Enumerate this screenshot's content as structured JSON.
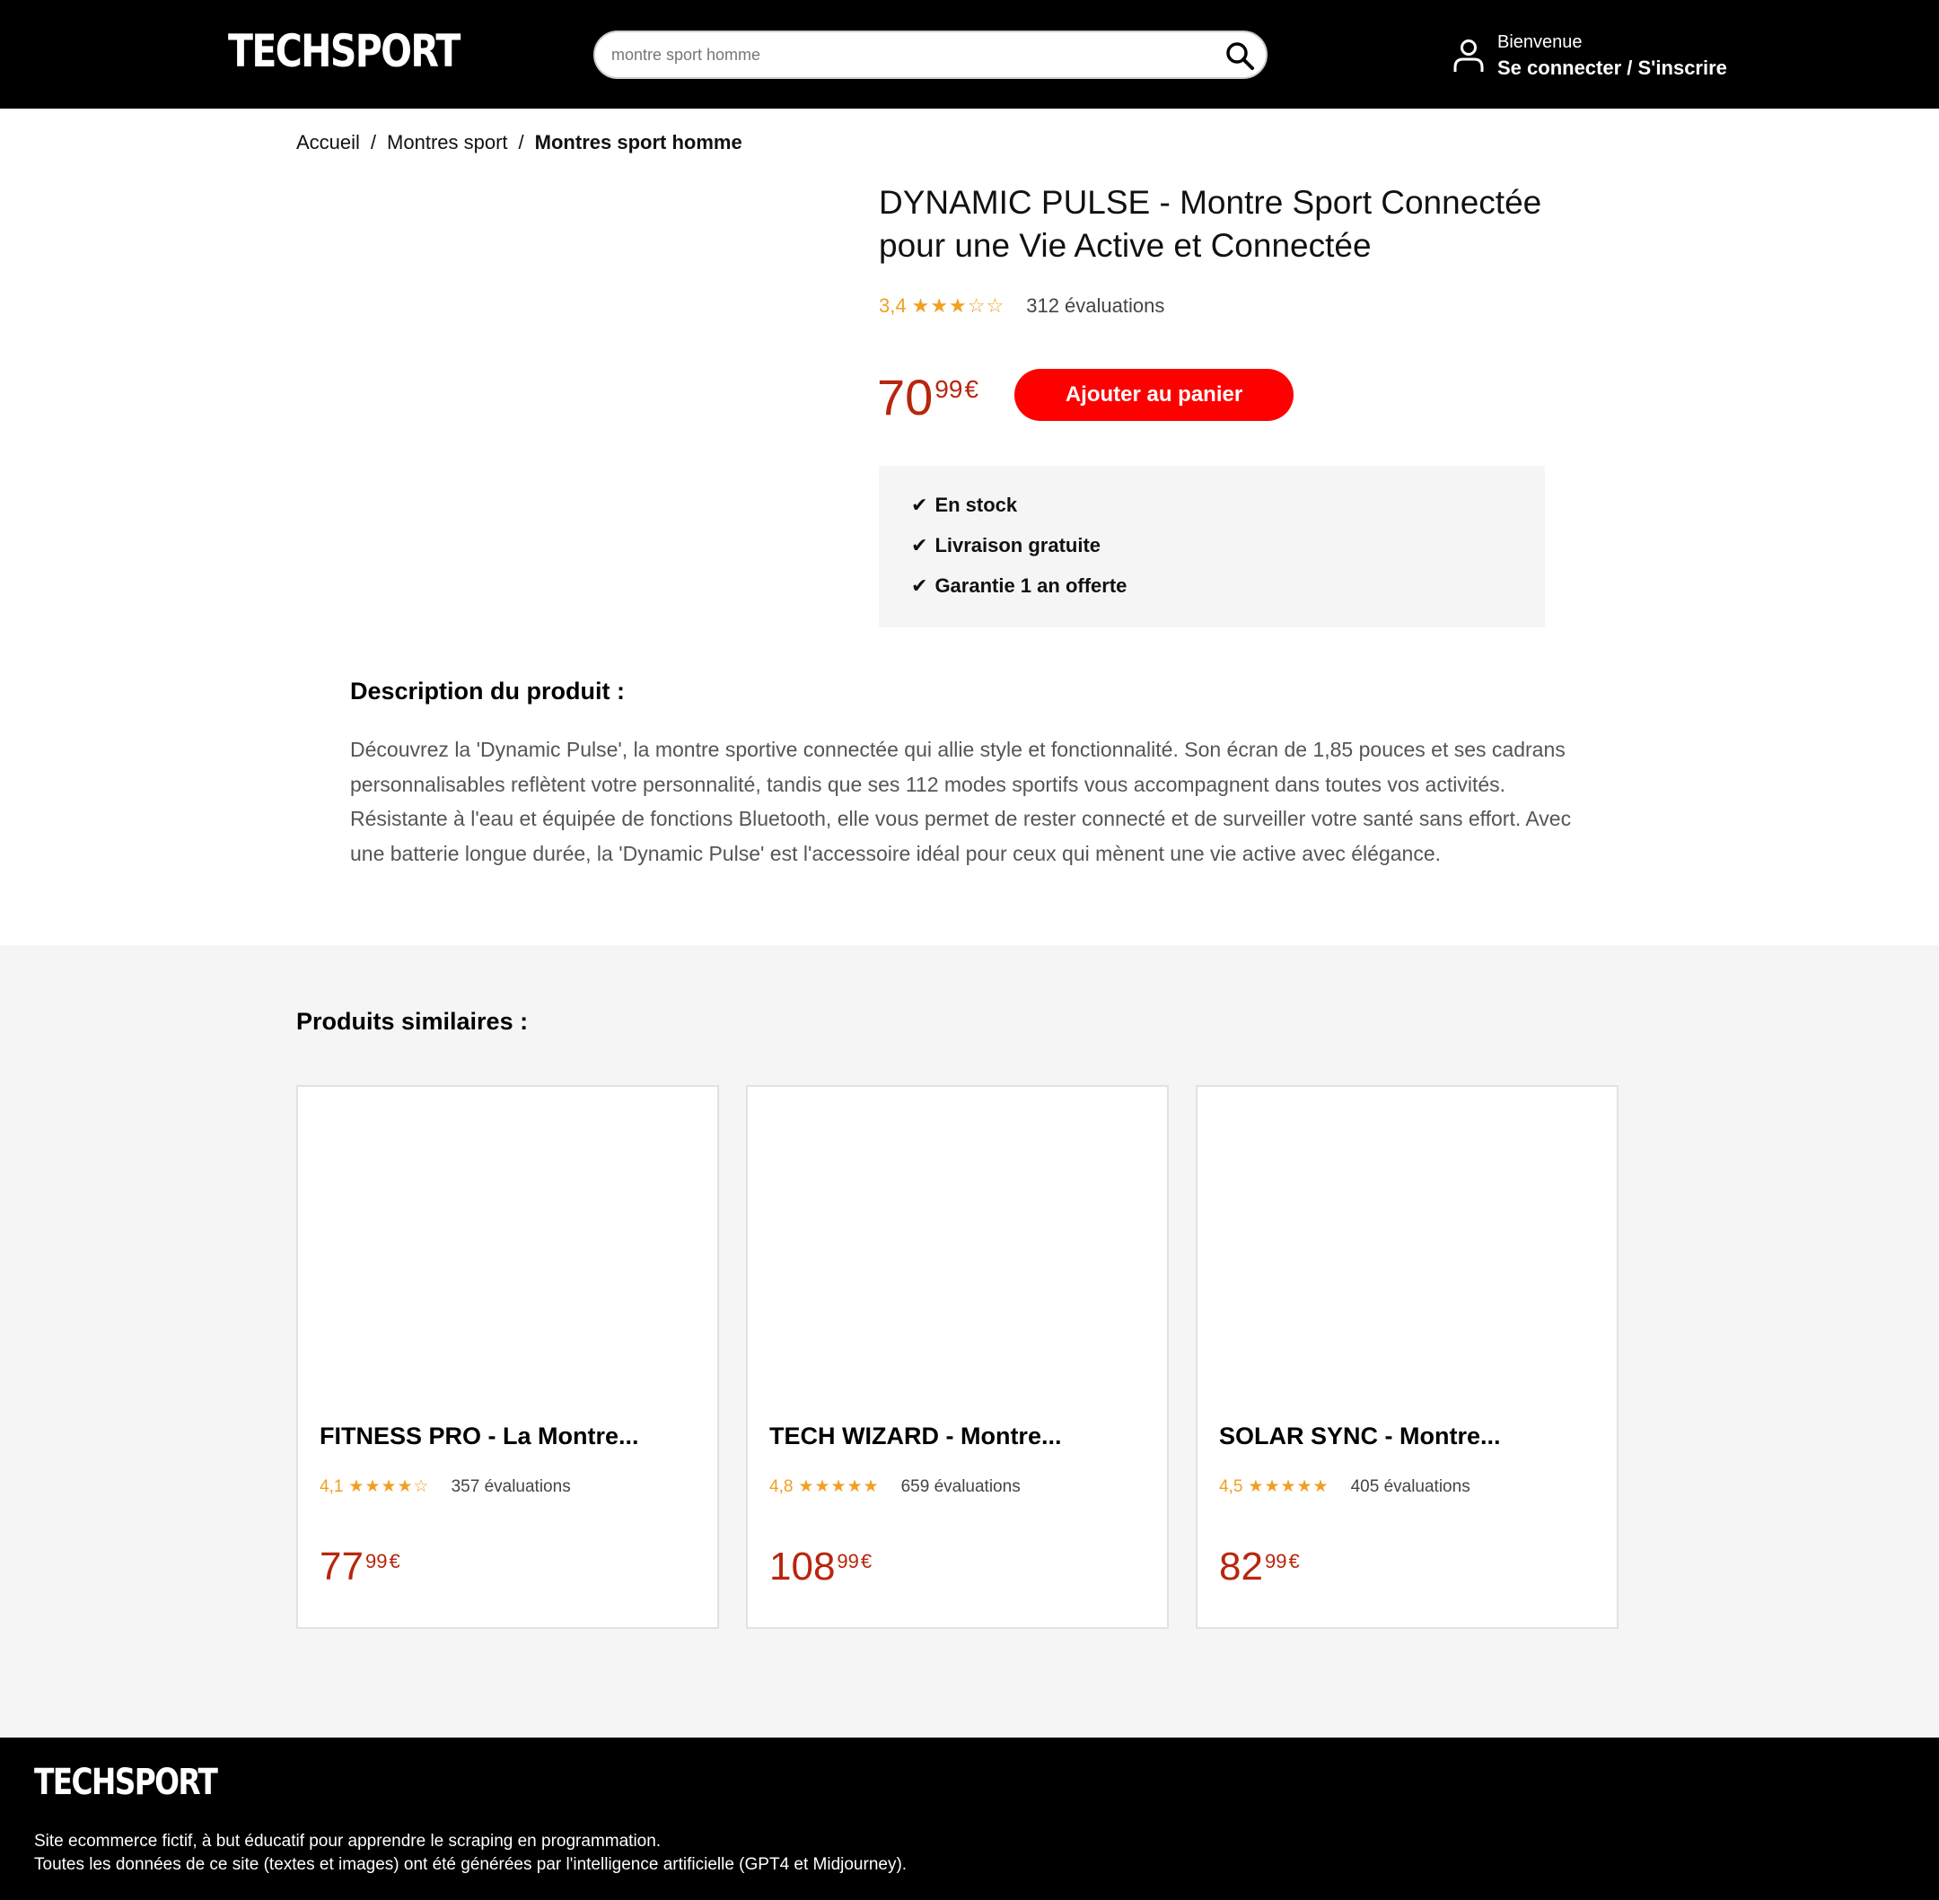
{
  "header": {
    "logo": "TECHSPORT",
    "search_placeholder": "montre sport homme",
    "welcome": "Bienvenue",
    "login": "Se connecter / S'inscrire"
  },
  "breadcrumb": {
    "items": [
      "Accueil",
      "Montres sport",
      "Montres sport homme"
    ],
    "separator": "/"
  },
  "product": {
    "title": "DYNAMIC PULSE - Montre Sport Connectée pour une Vie Active et Connectée",
    "rating": "3,4",
    "stars": "★★★☆☆",
    "reviews": "312 évaluations",
    "price_int": "70",
    "price_dec": "99",
    "currency": "€",
    "add_to_cart": "Ajouter au panier",
    "perks": [
      "En stock",
      "Livraison gratuite",
      "Garantie 1 an offerte"
    ],
    "check_glyph": "✔"
  },
  "description": {
    "title": "Description du produit :",
    "text": "Découvrez la 'Dynamic Pulse', la montre sportive connectée qui allie style et fonctionnalité. Son écran de 1,85 pouces et ses cadrans personnalisables reflètent votre personnalité, tandis que ses 112 modes sportifs vous accompagnent dans toutes vos activités. Résistante à l'eau et équipée de fonctions Bluetooth, elle vous permet de rester connecté et de surveiller votre santé sans effort. Avec une batterie longue durée, la 'Dynamic Pulse' est l'accessoire idéal pour ceux qui mènent une vie active avec élégance."
  },
  "similar": {
    "title": "Produits similaires :",
    "products": [
      {
        "title": "FITNESS PRO - La Montre...",
        "rating": "4,1",
        "stars": "★★★★☆",
        "reviews": "357 évaluations",
        "price_int": "77",
        "price_dec": "99",
        "currency": "€"
      },
      {
        "title": "TECH WIZARD - Montre...",
        "rating": "4,8",
        "stars": "★★★★★",
        "reviews": "659 évaluations",
        "price_int": "108",
        "price_dec": "99",
        "currency": "€"
      },
      {
        "title": "SOLAR SYNC - Montre...",
        "rating": "4,5",
        "stars": "★★★★★",
        "reviews": "405 évaluations",
        "price_int": "82",
        "price_dec": "99",
        "currency": "€"
      }
    ]
  },
  "footer": {
    "logo": "TECHSPORT",
    "line1": "Site ecommerce fictif, à but éducatif pour apprendre le scraping en programmation.",
    "line2": "Toutes les données de ce site (textes et images) ont été générées par l'intelligence artificielle (GPT4 et Midjourney)."
  },
  "colors": {
    "header_bg": "#000000",
    "accent_red": "#ff0000",
    "price_red": "#b8260c",
    "star_orange": "#f0a020",
    "panel_gray": "#f5f5f5"
  }
}
